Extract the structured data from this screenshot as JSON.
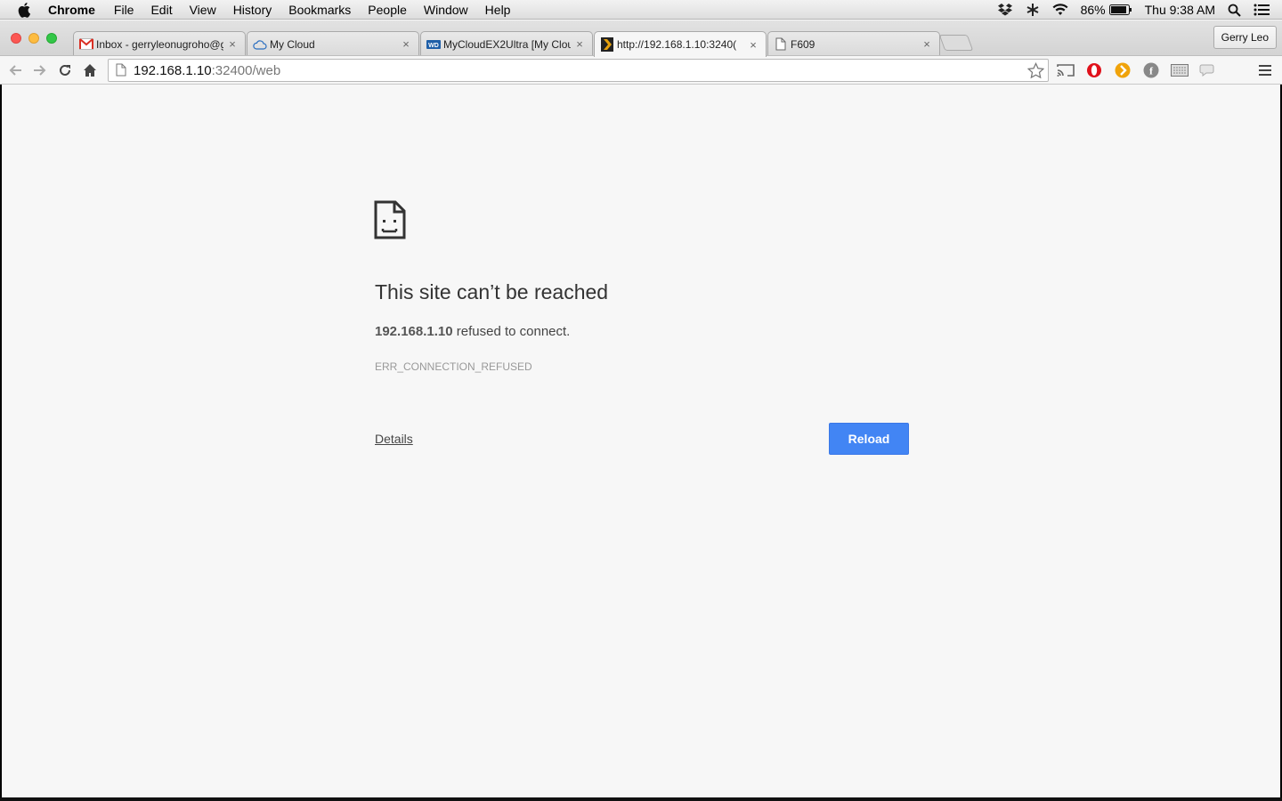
{
  "menubar": {
    "app_name": "Chrome",
    "items": [
      "File",
      "Edit",
      "View",
      "History",
      "Bookmarks",
      "People",
      "Window",
      "Help"
    ],
    "battery": "86%",
    "clock": "Thu 9:38 AM"
  },
  "tabs": [
    {
      "title": "Inbox - gerryleonugroho@g",
      "icon": "gmail-icon"
    },
    {
      "title": "My Cloud",
      "icon": "cloud-icon"
    },
    {
      "title": "MyCloudEX2Ultra [My Clou",
      "icon": "wd-icon"
    },
    {
      "title": "http://192.168.1.10:3240(",
      "icon": "plex-icon",
      "active": true
    },
    {
      "title": "F609",
      "icon": "page-icon"
    }
  ],
  "profile_name": "Gerry Leo",
  "omnibox": {
    "host": "192.168.1.10",
    "path": ":32400/web"
  },
  "error": {
    "title": "This site can’t be reached",
    "host": "192.168.1.10",
    "message_suffix": " refused to connect.",
    "code": "ERR_CONNECTION_REFUSED",
    "details_label": "Details",
    "reload_label": "Reload"
  },
  "colors": {
    "reload_button": "#4285f4",
    "page_background": "#f7f7f7"
  }
}
